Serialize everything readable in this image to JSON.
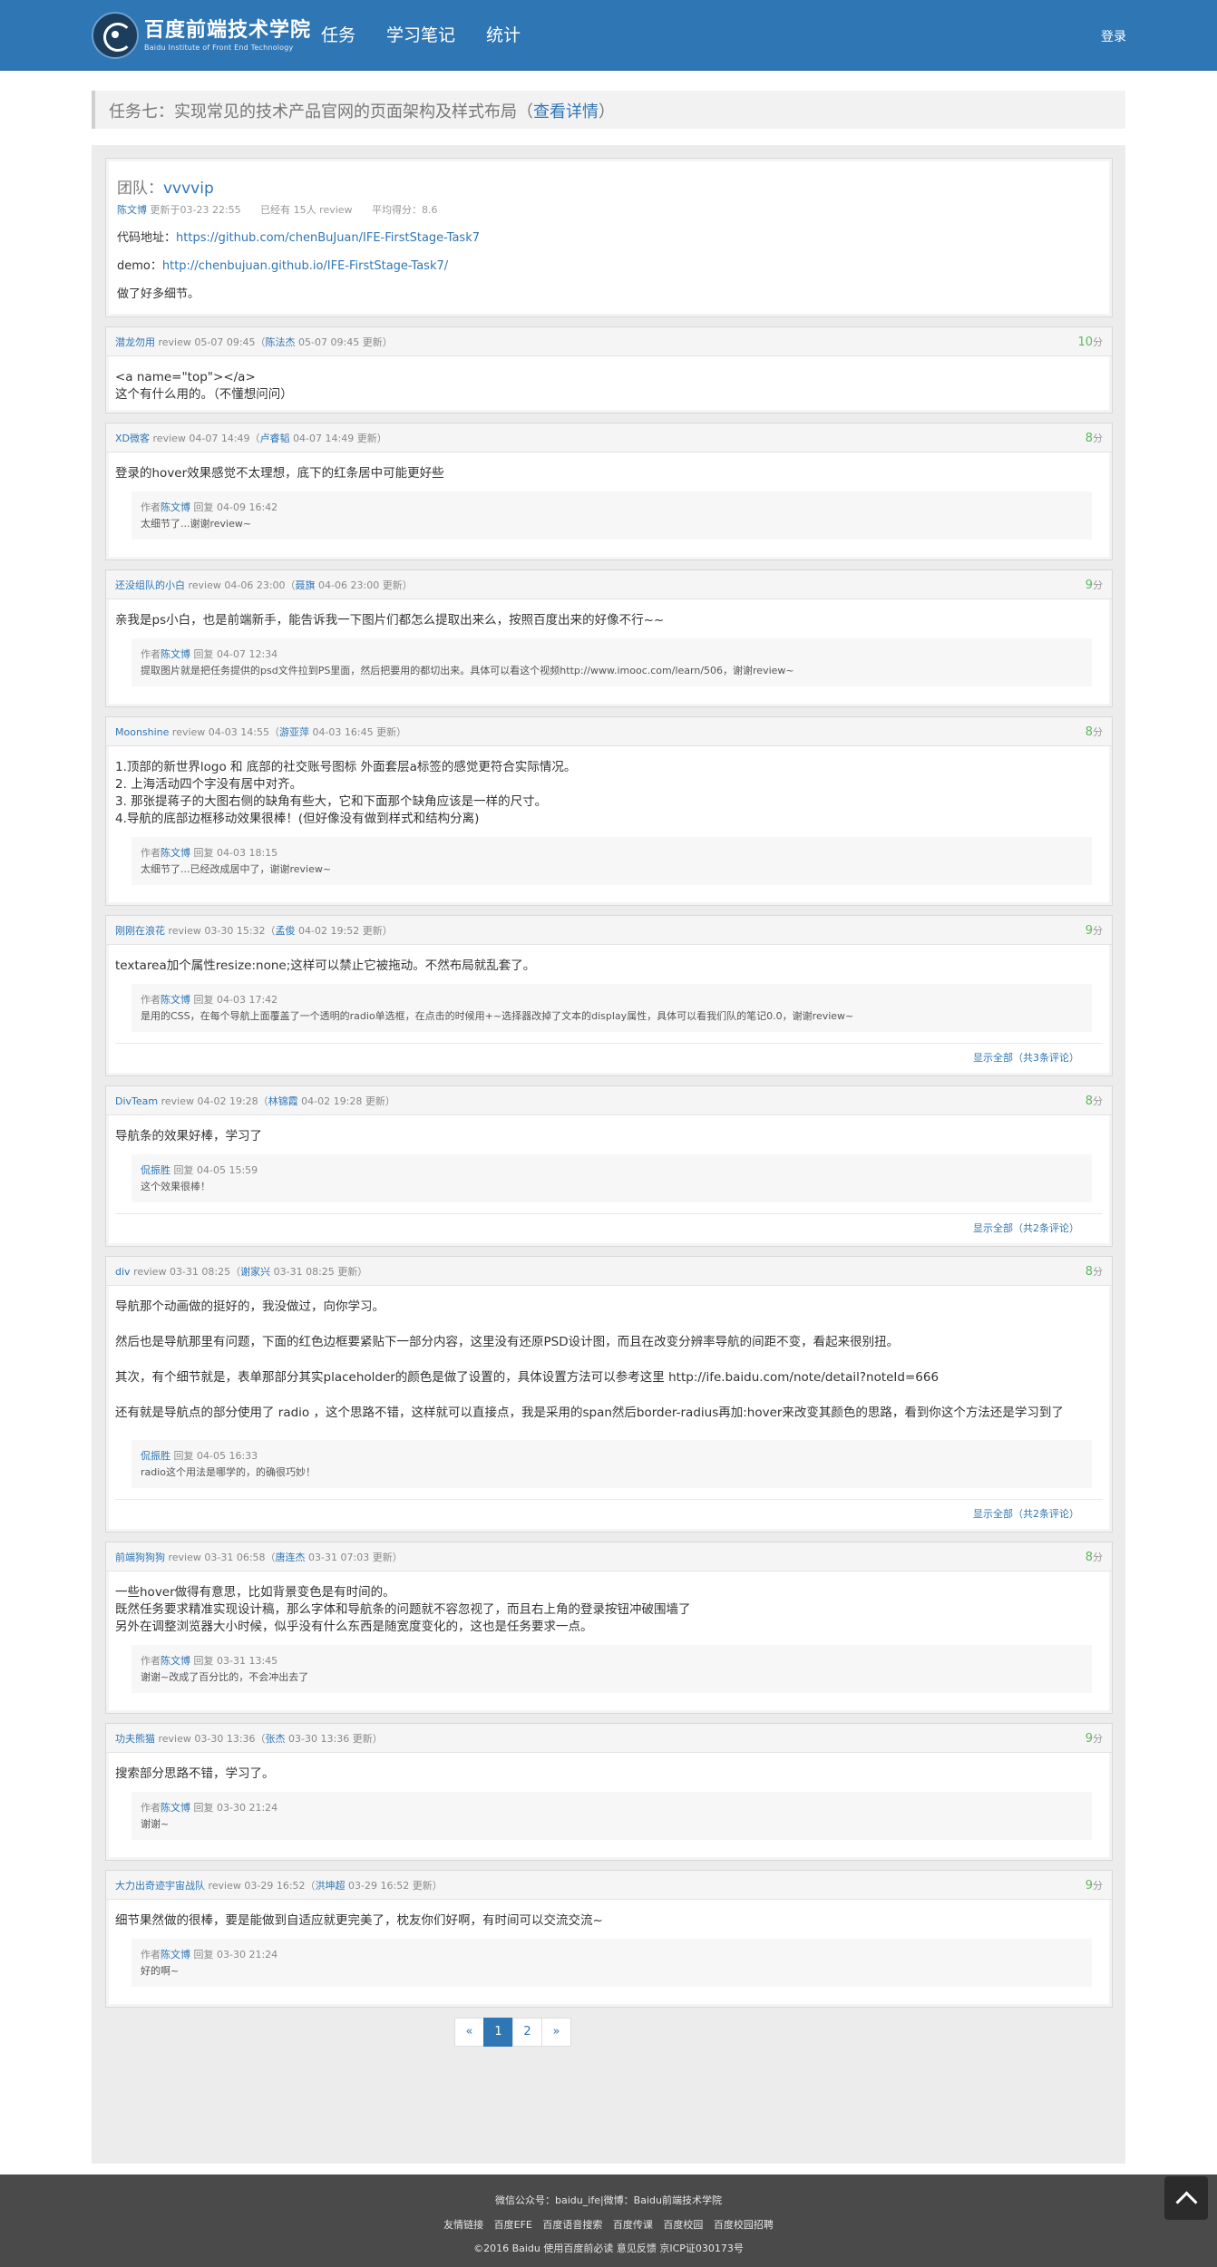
{
  "brand": {
    "title": "百度前端技术学院",
    "subtitle": "Baidu Institute of Front End Technology"
  },
  "nav": [
    "任务",
    "学习笔记",
    "统计"
  ],
  "login": "登录",
  "task": {
    "title": "任务七：实现常见的技术产品官网的页面架构及样式布局（",
    "detail": "查看详情",
    "close": "）"
  },
  "intro": {
    "team_label": "团队：",
    "team_name": "vvvvip",
    "author": "陈文博",
    "updated": "更新于03-23 22:55",
    "reviews": "已经有 15人 review",
    "avg": "平均得分：8.6",
    "code_label": "代码地址：",
    "code_url": "https://github.com/chenBuJuan/IFE-FirstStage-Task7",
    "demo_label": "demo：",
    "demo_url": "http://chenbujuan.github.io/IFE-FirstStage-Task7/",
    "note": "做了好多细节。"
  },
  "reviews": [
    {
      "user": "潜龙勿用",
      "time": "review 05-07 09:45（",
      "editor": "陈法杰",
      "edited": "05-07 09:45 更新）",
      "score": "10",
      "lines": [
        "<a name=\"top\"></a>",
        "这个有什么用的。（不懂想问问）"
      ],
      "replies": []
    },
    {
      "user": "XD微客",
      "time": "review 04-07 14:49（",
      "editor": "卢睿韬",
      "edited": "04-07 14:49 更新）",
      "score": "8",
      "lines": [
        "登录的hover效果感觉不太理想，底下的红条居中可能更好些"
      ],
      "replies": [
        {
          "prefix": "作者",
          "name": "陈文博",
          "when": "回复 04-09 16:42",
          "text": "太细节了...谢谢review~"
        }
      ]
    },
    {
      "user": "还没组队的小白",
      "time": "review 04-06 23:00（",
      "editor": "聂旗",
      "edited": "04-06 23:00 更新）",
      "score": "9",
      "lines": [
        "亲我是ps小白，也是前端新手，能告诉我一下图片们都怎么提取出来么，按照百度出来的好像不行~~"
      ],
      "replies": [
        {
          "prefix": "作者",
          "name": "陈文博",
          "when": "回复 04-07 12:34",
          "text": "提取图片就是把任务提供的psd文件拉到PS里面，然后把要用的都切出来。具体可以看这个视频http://www.imooc.com/learn/506，谢谢review~"
        }
      ]
    },
    {
      "user": "Moonshine",
      "time": "review 04-03 14:55（",
      "editor": "游亚萍",
      "edited": "04-03 16:45 更新）",
      "score": "8",
      "lines": [
        "1.顶部的新世界logo 和 底部的社交账号图标 外面套层a标签的感觉更符合实际情况。",
        "2. 上海活动四个字没有居中对齐。",
        "3. 那张提蒋子的大图右侧的缺角有些大，它和下面那个缺角应该是一样的尺寸。",
        "4.导航的底部边框移动效果很棒！(但好像没有做到样式和结构分离)"
      ],
      "replies": [
        {
          "prefix": "作者",
          "name": "陈文博",
          "when": "回复 04-03 18:15",
          "text": "太细节了...已经改成居中了，谢谢review~"
        }
      ]
    },
    {
      "user": "刚刚在浪花",
      "time": "review 03-30 15:32（",
      "editor": "孟俊",
      "edited": "04-02 19:52 更新）",
      "score": "9",
      "lines": [
        "textarea加个属性resize:none;这样可以禁止它被拖动。不然布局就乱套了。"
      ],
      "replies": [
        {
          "prefix": "作者",
          "name": "陈文博",
          "when": "回复 04-03 17:42",
          "text": "是用的CSS，在每个导航上面覆盖了一个透明的radio单选框，在点击的时候用+~选择器改掉了文本的display属性，具体可以看我们队的笔记0.0，谢谢review~"
        }
      ],
      "show_all": "显示全部（共3条评论）"
    },
    {
      "user": "DivTeam",
      "time": "review 04-02 19:28（",
      "editor": "林锦霞",
      "edited": "04-02 19:28 更新）",
      "score": "8",
      "lines": [
        "导航条的效果好棒，学习了"
      ],
      "replies": [
        {
          "prefix": "",
          "name": "侃振胜",
          "when": "回复 04-05 15:59",
          "text": "这个效果很棒！"
        }
      ],
      "show_all": "显示全部（共2条评论）"
    },
    {
      "user": "div",
      "time": "review 03-31 08:25（",
      "editor": "谢家兴",
      "edited": "03-31 08:25 更新）",
      "score": "8",
      "lines": [
        "导航那个动画做的挺好的，我没做过，向你学习。",
        "然后也是导航那里有问题，下面的红色边框要紧贴下一部分内容，这里没有还原PSD设计图，而且在改变分辨率导航的间距不变，看起来很别扭。",
        "其次，有个细节就是，表单那部分其实placeholder的颜色是做了设置的，具体设置方法可以参考这里 http://ife.baidu.com/note/detail?noteId=666",
        "还有就是导航点的部分使用了 radio ，这个思路不错，这样就可以直接点，我是采用的span然后border-radius再加:hover来改变其颜色的思路，看到你这个方法还是学习到了"
      ],
      "spaced": true,
      "replies": [
        {
          "prefix": "",
          "name": "侃振胜",
          "when": "回复 04-05 16:33",
          "text": "radio这个用法是哪学的，的确很巧妙！"
        }
      ],
      "show_all": "显示全部（共2条评论）"
    },
    {
      "user": "前端狗狗狗",
      "time": "review 03-31 06:58（",
      "editor": "唐连杰",
      "edited": "03-31 07:03 更新）",
      "score": "8",
      "lines": [
        "一些hover做得有意思，比如背景变色是有时间的。",
        "既然任务要求精准实现设计稿，那么字体和导航条的问题就不容忽视了，而且右上角的登录按钮冲破围墙了",
        "另外在调整浏览器大小时候，似乎没有什么东西是随宽度变化的，这也是任务要求一点。"
      ],
      "replies": [
        {
          "prefix": "作者",
          "name": "陈文博",
          "when": "回复 03-31 13:45",
          "text": "谢谢~改成了百分比的，不会冲出去了"
        }
      ]
    },
    {
      "user": "功夫熊猫",
      "time": "review 03-30 13:36（",
      "editor": "张杰",
      "edited": "03-30 13:36 更新）",
      "score": "9",
      "lines": [
        "搜索部分思路不错，学习了。"
      ],
      "replies": [
        {
          "prefix": "作者",
          "name": "陈文博",
          "when": "回复 03-30 21:24",
          "text": "谢谢~"
        }
      ]
    },
    {
      "user": "大力出奇迹宇宙战队",
      "time": "review 03-29 16:52（",
      "editor": "洪坤超",
      "edited": "03-29 16:52 更新）",
      "score": "9",
      "lines": [
        "细节果然做的很棒，要是能做到自适应就更完美了，枕友你们好啊，有时间可以交流交流~"
      ],
      "replies": [
        {
          "prefix": "作者",
          "name": "陈文博",
          "when": "回复 03-30 21:24",
          "text": "好的啊~"
        }
      ]
    }
  ],
  "score_unit": "分",
  "pagination": [
    "«",
    "1",
    "2",
    "»"
  ],
  "footer": {
    "line1": "微信公众号：baidu_ife|微博：Baidu前端技术学院",
    "links": [
      "友情链接",
      "百度EFE",
      "百度语音搜索",
      "百度传课",
      "百度校园",
      "百度校园招聘"
    ],
    "line3": "©2016 Baidu 使用百度前必读 意见反馈 京ICP证030173号"
  },
  "colors": {
    "primary": "#2f76b5",
    "score": "#5cb85c",
    "footer": "#4a4a4a"
  }
}
